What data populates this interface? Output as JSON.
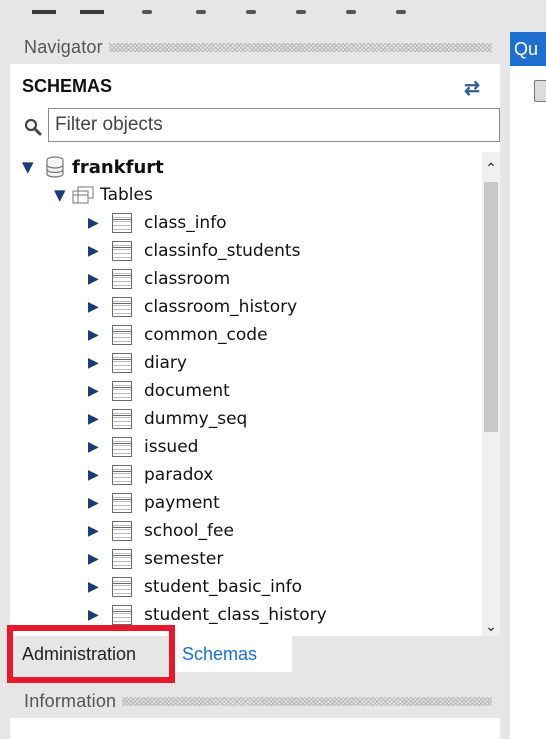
{
  "navigator": {
    "title": "Navigator",
    "schemas_label": "SCHEMAS",
    "filter_placeholder": "Filter objects",
    "schema": {
      "name": "frankfurt",
      "tables_label": "Tables"
    },
    "tables": [
      "class_info",
      "classinfo_students",
      "classroom",
      "classroom_history",
      "common_code",
      "diary",
      "document",
      "dummy_seq",
      "issued",
      "paradox",
      "payment",
      "school_fee",
      "semester",
      "student_basic_info",
      "student_class_history"
    ]
  },
  "tabs": {
    "administration": "Administration",
    "schemas": "Schemas"
  },
  "information": {
    "title": "Information"
  },
  "right_panel": {
    "tab_label": "Qu"
  },
  "colors": {
    "accent": "#1f6fd1",
    "highlight": "#e8192c",
    "link": "#1a6fd6"
  },
  "icons": {
    "refresh": "refresh-icon",
    "search": "search-icon",
    "database": "database-icon",
    "folder": "tables-folder-icon",
    "table": "table-icon"
  }
}
